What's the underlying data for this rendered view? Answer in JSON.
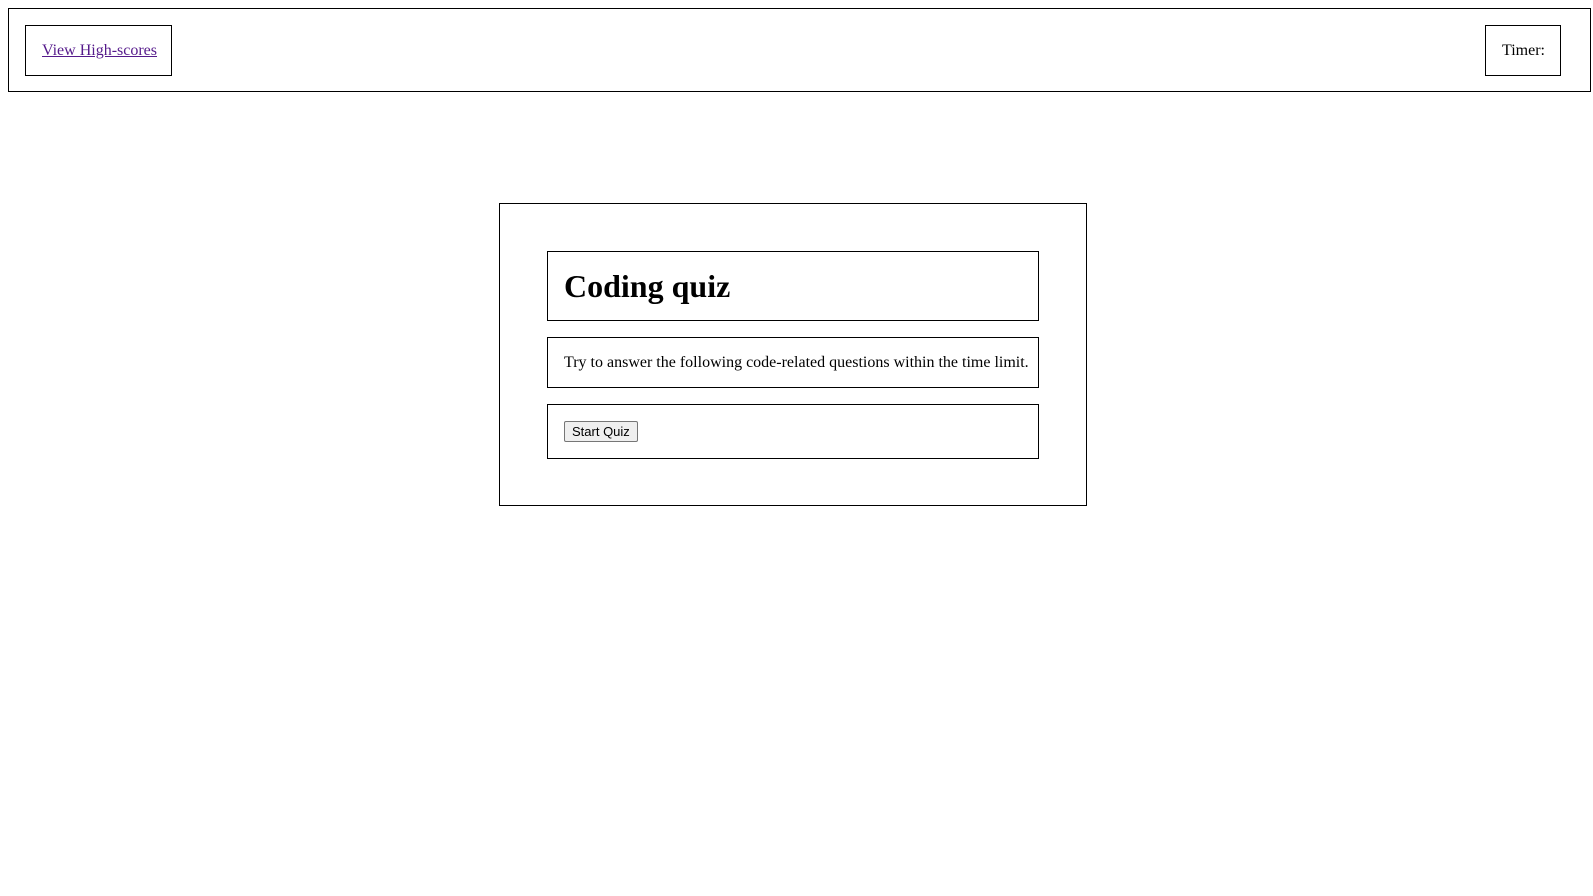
{
  "header": {
    "highscores_label": "View High-scores",
    "timer_label": "Timer:"
  },
  "main": {
    "title": "Coding quiz",
    "description": "Try to answer the following code-related questions within the time limit.",
    "start_button_label": "Start Quiz"
  },
  "colors": {
    "link_visited": "#551a8b",
    "border": "#000000",
    "background": "#ffffff"
  }
}
